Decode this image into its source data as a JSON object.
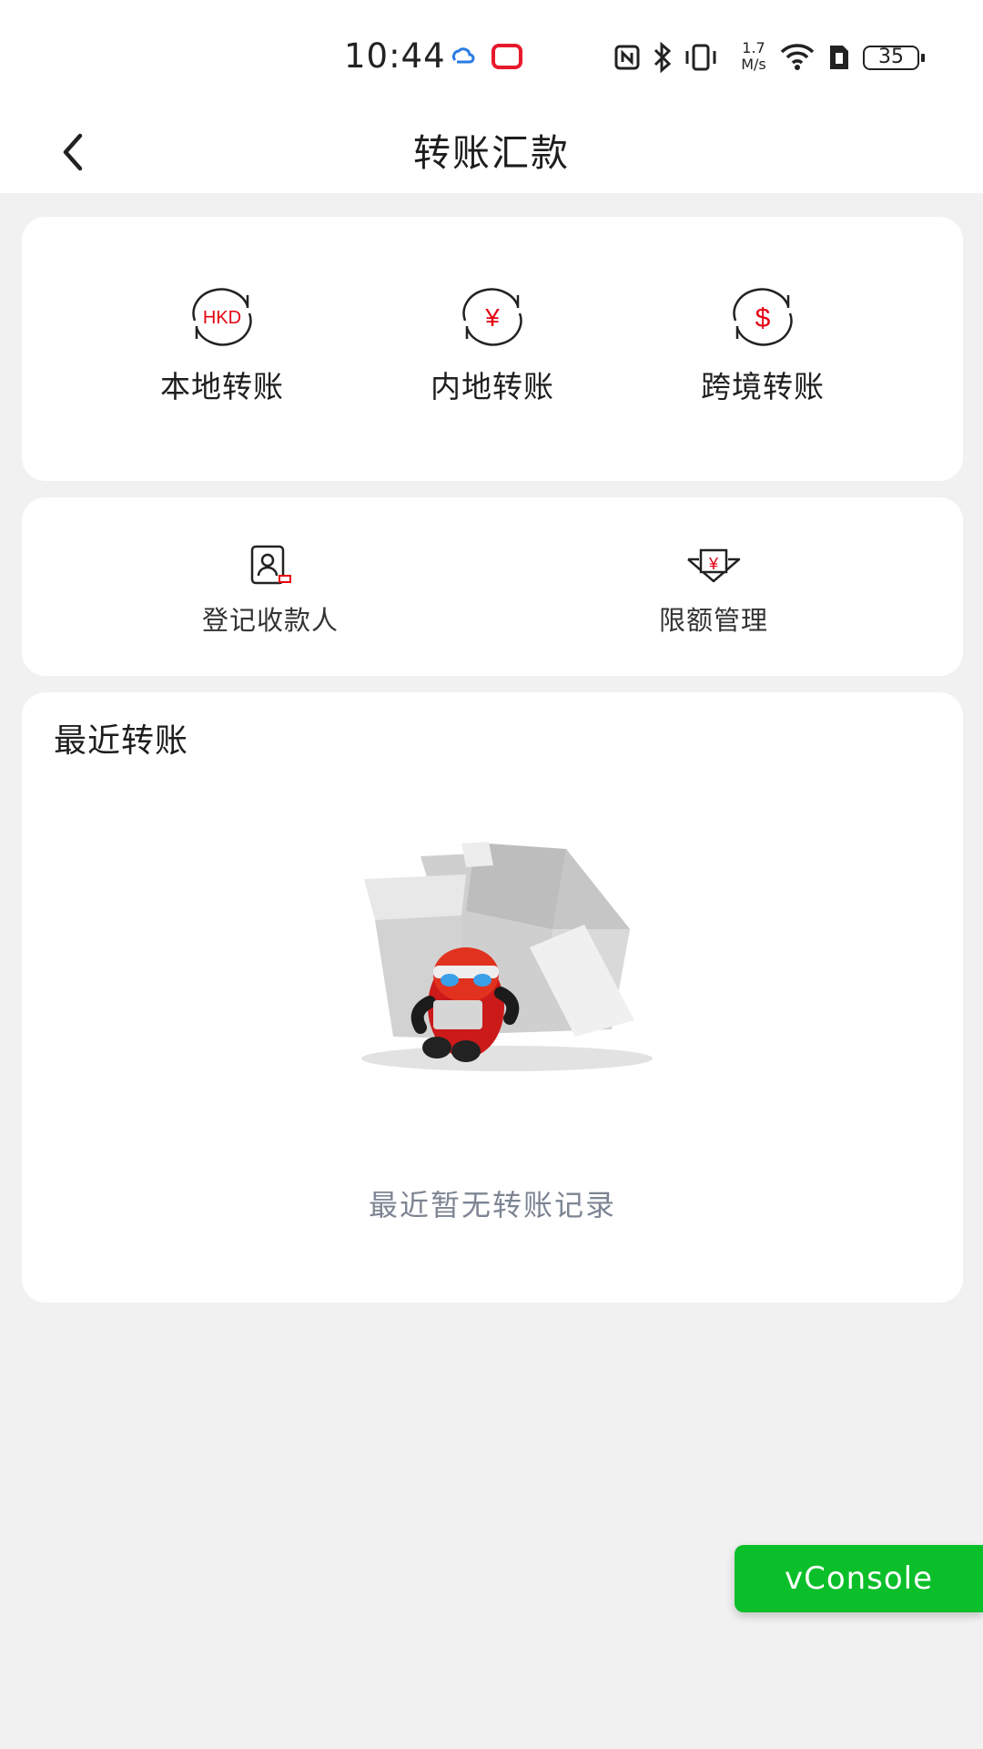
{
  "status_bar": {
    "time": "10:44",
    "network_speed_value": "1.7",
    "network_speed_unit": "M/s",
    "battery": "35",
    "icons": [
      "weather-icon",
      "screen-record-icon",
      "nfc-icon",
      "bluetooth-icon",
      "vibrate-icon",
      "wifi-icon",
      "sim-icon",
      "battery-icon"
    ]
  },
  "header": {
    "title": "转账汇款",
    "back_icon": "chevron-left-icon"
  },
  "transfer_types": [
    {
      "label": "本地转账",
      "icon": "hkd-exchange-icon",
      "icon_text": "HKD"
    },
    {
      "label": "内地转账",
      "icon": "rmb-exchange-icon",
      "icon_text": "¥"
    },
    {
      "label": "跨境转账",
      "icon": "usd-exchange-icon",
      "icon_text": "$"
    }
  ],
  "utilities": [
    {
      "label": "登记收款人",
      "icon": "payee-card-icon"
    },
    {
      "label": "限额管理",
      "icon": "limit-management-icon",
      "icon_text": "¥"
    }
  ],
  "recent": {
    "title": "最近转账",
    "empty_text": "最近暂无转账记录",
    "illustration": "empty-box-illustration"
  },
  "floating": {
    "vconsole_label": "vConsole"
  },
  "colors": {
    "accent_red": "#e60012",
    "vconsole_green": "#0bbf2a",
    "background": "#f1f1f1"
  }
}
